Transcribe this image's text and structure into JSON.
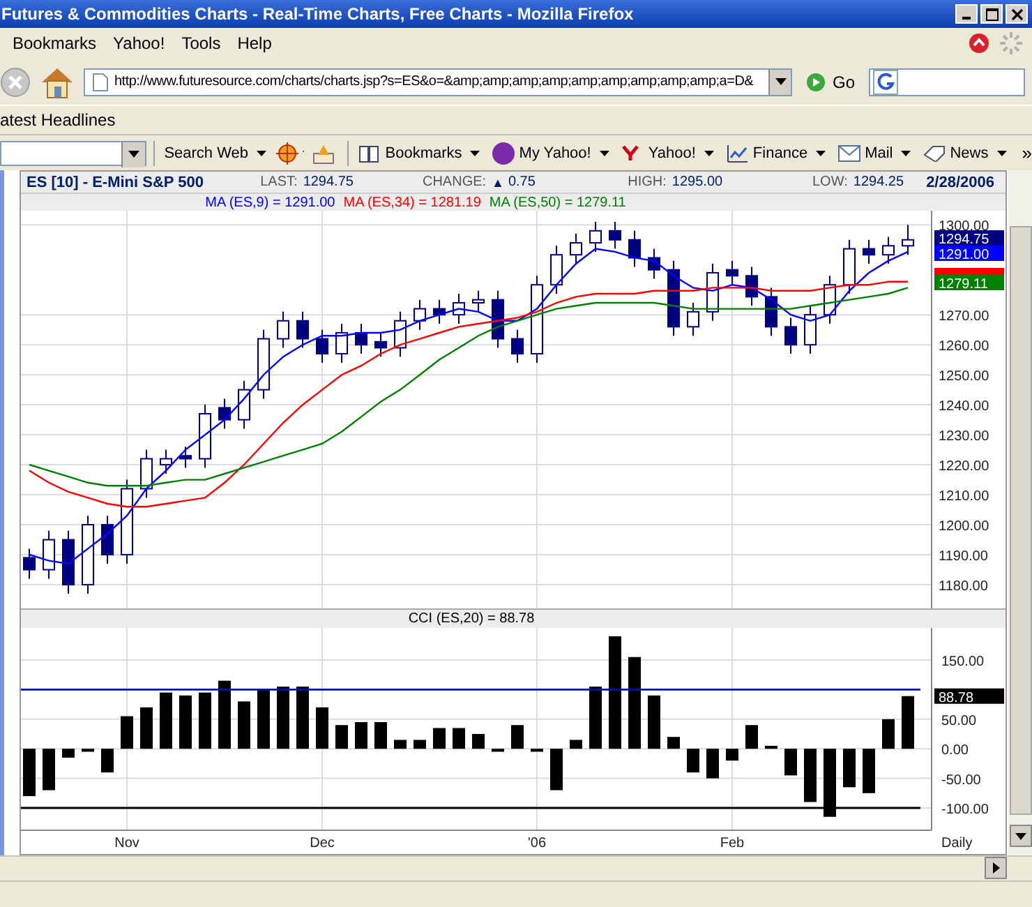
{
  "window": {
    "title": "Futures & Commodities Charts - Real-Time Charts, Free Charts - Mozilla Firefox"
  },
  "menu": [
    {
      "label": "Bookmarks"
    },
    {
      "label": "Yahoo!"
    },
    {
      "label": "Tools"
    },
    {
      "label": "Help"
    }
  ],
  "address_bar": {
    "value": "http://www.futuresource.com/charts/charts.jsp?s=ES&o=&amp;amp;amp;amp;amp;amp;amp;amp;amp;a=D&",
    "go": "Go"
  },
  "bookmarks_bar": [
    {
      "label": "atest Headlines"
    }
  ],
  "yahoo_toolbar": {
    "items": [
      {
        "label": "Search Web"
      },
      {
        "label": "Bookmarks"
      },
      {
        "label": "My Yahoo!"
      },
      {
        "label": "Yahoo!"
      },
      {
        "label": "Finance"
      },
      {
        "label": "Mail"
      },
      {
        "label": "News"
      }
    ],
    "overflow": "»"
  },
  "chart_header": {
    "symbol": "ES [10] - E-Mini S&P 500",
    "last_label": "LAST:",
    "last": "1294.75",
    "change_label": "CHANGE:",
    "change_arrow": "▲",
    "change": "0.75",
    "high_label": "HIGH:",
    "high": "1295.00",
    "low_label": "LOW:",
    "low": "1294.25",
    "date": "2/28/2006"
  },
  "legend": [
    {
      "value": "= 1291.00"
    },
    {
      "value": "= 1281.19"
    },
    {
      "value": "= 1279.11"
    }
  ],
  "price_tags": [
    {
      "text": "1294.75",
      "color": "#000080"
    },
    {
      "text": "1291.00",
      "color": "#0000ff"
    },
    {
      "color": "#ff0000"
    },
    {
      "text": "1279.11",
      "color": "#008000"
    }
  ],
  "price_chart": {
    "chart_data": {
      "type": "candlestick",
      "grid": true,
      "ylim": [
        1172.1,
        1304.7
      ],
      "yticks": [
        {
          "value": 1180,
          "label": "1180.00"
        },
        {
          "value": 1190,
          "label": "1190.00"
        },
        {
          "value": 1200,
          "label": "1200.00"
        },
        {
          "value": 1210,
          "label": "1210.00"
        },
        {
          "value": 1220,
          "label": "1220.00"
        },
        {
          "value": 1230,
          "label": "1230.00"
        },
        {
          "value": 1240,
          "label": "1240.00"
        },
        {
          "value": 1250,
          "label": "1250.00"
        },
        {
          "value": 1260,
          "label": "1260.00"
        },
        {
          "value": 1270,
          "label": "1270.00"
        },
        {
          "value": 1300,
          "label": "1300.00"
        }
      ],
      "ohlc": [
        [
          1189,
          1192,
          1182,
          1185
        ],
        [
          1185,
          1198,
          1182,
          1195
        ],
        [
          1195,
          1198,
          1177,
          1180
        ],
        [
          1180,
          1203,
          1177,
          1200
        ],
        [
          1200,
          1203,
          1187,
          1190
        ],
        [
          1190,
          1215,
          1187,
          1212
        ],
        [
          1212,
          1225,
          1209,
          1222
        ],
        [
          1220,
          1225,
          1217,
          1222
        ],
        [
          1223,
          1226,
          1219,
          1222
        ],
        [
          1222,
          1240,
          1219,
          1237
        ],
        [
          1239,
          1242,
          1232,
          1235
        ],
        [
          1235,
          1248,
          1232,
          1245
        ],
        [
          1245,
          1265,
          1242,
          1262
        ],
        [
          1262,
          1271,
          1259,
          1268
        ],
        [
          1268,
          1271,
          1259,
          1262
        ],
        [
          1262,
          1265,
          1254,
          1257
        ],
        [
          1257,
          1267,
          1254,
          1264
        ],
        [
          1264,
          1267,
          1257,
          1260
        ],
        [
          1261,
          1264,
          1256,
          1259
        ],
        [
          1259,
          1271,
          1256,
          1268
        ],
        [
          1268,
          1275,
          1265,
          1272
        ],
        [
          1272,
          1275,
          1267,
          1270
        ],
        [
          1270,
          1277,
          1267,
          1274
        ],
        [
          1274,
          1278,
          1271,
          1275
        ],
        [
          1275,
          1278,
          1259,
          1262
        ],
        [
          1262,
          1265,
          1254,
          1257
        ],
        [
          1257,
          1283,
          1254,
          1280
        ],
        [
          1280,
          1293,
          1277,
          1290
        ],
        [
          1290,
          1297,
          1287,
          1294
        ],
        [
          1294,
          1301,
          1291,
          1298
        ],
        [
          1298,
          1301,
          1292,
          1295
        ],
        [
          1295,
          1298,
          1286,
          1289
        ],
        [
          1289,
          1292,
          1282,
          1285
        ],
        [
          1285,
          1288,
          1263,
          1266
        ],
        [
          1266,
          1274,
          1263,
          1271
        ],
        [
          1271,
          1287,
          1268,
          1284
        ],
        [
          1285,
          1288,
          1280,
          1283
        ],
        [
          1283,
          1286,
          1273,
          1276
        ],
        [
          1276,
          1279,
          1263,
          1266
        ],
        [
          1266,
          1269,
          1257,
          1260
        ],
        [
          1260,
          1273,
          1257,
          1270
        ],
        [
          1270,
          1283,
          1267,
          1280
        ],
        [
          1280,
          1295,
          1277,
          1292
        ],
        [
          1292,
          1295,
          1287,
          1290
        ],
        [
          1290,
          1296,
          1287,
          1293
        ],
        [
          1293,
          1300,
          1290,
          1295
        ]
      ],
      "series": [
        {
          "name": "MA (ES,9)",
          "type": "line",
          "color": "#0000ff",
          "values": [
            1190,
            1188,
            1187,
            1192,
            1197,
            1203,
            1212,
            1218,
            1225,
            1230,
            1235,
            1242,
            1250,
            1256,
            1260,
            1263,
            1263,
            1264,
            1264,
            1265,
            1268,
            1270,
            1272,
            1271,
            1268,
            1268,
            1272,
            1280,
            1287,
            1292,
            1291,
            1289,
            1288,
            1283,
            1279,
            1278,
            1280,
            1279,
            1275,
            1270,
            1268,
            1270,
            1278,
            1284,
            1288,
            1291
          ]
        },
        {
          "name": "MA (ES,34)",
          "type": "line",
          "color": "#ff0000",
          "values": [
            1218,
            1214,
            1211,
            1209,
            1207,
            1206,
            1206,
            1207,
            1208,
            1209,
            1214,
            1220,
            1227,
            1234,
            1240,
            1245,
            1250,
            1253,
            1257,
            1260,
            1262,
            1264,
            1266,
            1267,
            1268,
            1269,
            1271,
            1274,
            1276,
            1277,
            1277,
            1277,
            1278,
            1278,
            1278,
            1279,
            1279,
            1279,
            1278,
            1278,
            1278,
            1279,
            1280,
            1280,
            1281,
            1281
          ]
        },
        {
          "name": "MA (ES,50)",
          "type": "line",
          "color": "#008000",
          "values": [
            1220,
            1218,
            1216,
            1214,
            1213,
            1213,
            1213,
            1214,
            1215,
            1215,
            1217,
            1219,
            1221,
            1223,
            1225,
            1227,
            1231,
            1236,
            1241,
            1245,
            1250,
            1255,
            1259,
            1263,
            1266,
            1268,
            1270,
            1272,
            1273,
            1274,
            1274,
            1274,
            1274,
            1273,
            1272,
            1272,
            1272,
            1272,
            1272,
            1272,
            1273,
            1274,
            1275,
            1276,
            1277,
            1279
          ]
        }
      ]
    }
  },
  "cci_chart": {
    "title_value": "= 88.78",
    "value_tag": "88.78",
    "frequency": "Daily",
    "chart_data": {
      "type": "bar",
      "grid": true,
      "ylim": [
        -137.7,
        204.2
      ],
      "yticks": [
        {
          "value": -100,
          "label": "-100.00"
        },
        {
          "value": -50,
          "label": "-50.00"
        },
        {
          "value": 0,
          "label": "0.00"
        },
        {
          "value": 50,
          "label": "50.00"
        },
        {
          "value": 150,
          "label": "150.00"
        }
      ],
      "categories": [
        null,
        null,
        null,
        null,
        null,
        "Nov",
        null,
        null,
        null,
        null,
        null,
        null,
        null,
        null,
        null,
        "Dec",
        null,
        null,
        null,
        null,
        null,
        null,
        null,
        null,
        null,
        null,
        "'06",
        null,
        null,
        null,
        null,
        null,
        null,
        null,
        null,
        null,
        "Feb",
        null,
        null,
        null,
        null,
        null,
        null,
        null,
        null,
        null
      ],
      "ref_lines": [
        {
          "axis": "y",
          "value": 100,
          "color": "#0000ff"
        },
        {
          "axis": "y",
          "value": -100,
          "color": "#000000"
        }
      ],
      "series": [
        {
          "name": "CCI (ES,20)",
          "color": "#000000",
          "values": [
            -80,
            -70,
            -15,
            -5,
            -40,
            55,
            70,
            95,
            90,
            95,
            115,
            80,
            100,
            105,
            105,
            70,
            40,
            45,
            45,
            15,
            15,
            35,
            35,
            25,
            -5,
            40,
            -5,
            -70,
            15,
            105,
            190,
            155,
            90,
            20,
            -40,
            -50,
            -20,
            40,
            5,
            -45,
            -90,
            -115,
            -65,
            -75,
            50,
            89
          ]
        }
      ]
    }
  }
}
